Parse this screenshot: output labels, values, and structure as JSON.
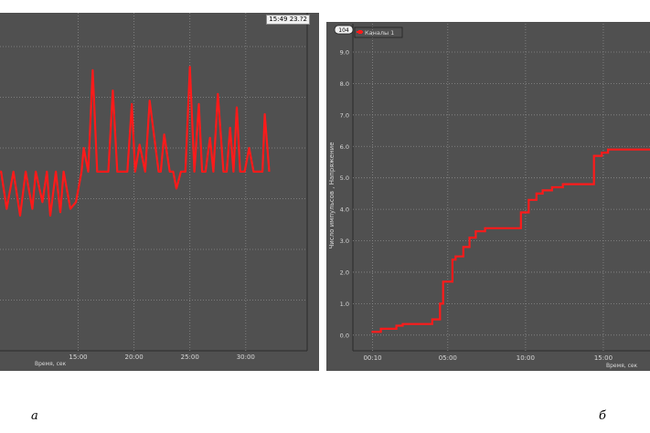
{
  "captions": {
    "a": "а",
    "b": "б"
  },
  "colors": {
    "background": "#505050",
    "series": "#ff1a1a",
    "grid": "#8a8a8a",
    "axis_text": "#d8d8d8"
  },
  "chart_data": [
    {
      "id": "a",
      "type": "line",
      "title": "",
      "timestamp": "15:49 23.?2",
      "xlabel": "Время, сек",
      "ylabel": "",
      "xticks": [
        "15:00",
        "20:00",
        "25:00",
        "30:00"
      ],
      "xlim": [
        8.0,
        35.5
      ],
      "ylim": [
        0,
        10
      ],
      "grid": true,
      "series": [
        {
          "x": [
            8.0,
            8.1,
            8.6,
            9.2,
            9.8,
            10.3,
            10.9,
            11.2,
            11.8,
            12.2,
            12.5,
            13.0,
            13.4,
            13.7,
            14.3,
            14.8,
            15.3,
            15.5,
            15.9,
            16.3,
            16.7,
            17.1,
            17.4,
            17.7,
            18.1,
            18.5,
            18.9,
            19.4,
            19.8,
            20.1,
            20.5,
            21.0,
            21.4,
            22.2,
            22.4,
            22.7,
            23.2,
            23.5,
            23.8,
            24.2,
            24.6,
            25.0,
            25.4,
            25.8,
            26.1,
            26.4,
            26.8,
            27.1,
            27.5,
            28.0,
            28.3,
            28.6,
            28.9,
            29.2,
            29.5,
            29.9,
            30.3,
            30.7,
            31.1,
            31.5,
            31.7,
            32.1
          ],
          "y": [
            5.3,
            5.3,
            4.2,
            5.3,
            4.0,
            5.3,
            4.2,
            5.3,
            4.4,
            5.3,
            4.0,
            5.3,
            4.1,
            5.3,
            4.2,
            4.4,
            5.3,
            6.0,
            5.3,
            8.3,
            5.3,
            5.3,
            5.3,
            5.3,
            7.7,
            5.3,
            5.3,
            5.3,
            7.3,
            5.3,
            6.1,
            5.3,
            7.4,
            5.3,
            5.3,
            6.4,
            5.3,
            5.3,
            4.8,
            5.3,
            5.3,
            8.4,
            5.3,
            7.3,
            5.3,
            5.3,
            6.3,
            5.3,
            7.6,
            5.3,
            5.3,
            6.6,
            5.3,
            7.2,
            5.3,
            5.3,
            6.0,
            5.3,
            5.3,
            5.3,
            7.0,
            5.3
          ]
        }
      ]
    },
    {
      "id": "b",
      "type": "line",
      "title": "",
      "legend_box_value": "104",
      "legend": [
        "Каналы 1"
      ],
      "xlabel": "Время, сек",
      "ylabel": "Число импульсов , Напряжение",
      "yticks": [
        "0.0",
        "1.0",
        "2.0",
        "3.0",
        "4.0",
        "5.0",
        "6.0",
        "7.0",
        "8.0",
        "9.0"
      ],
      "xticks": [
        "00:10",
        "05:00",
        "10:00",
        "15:00"
      ],
      "xlim": [
        -1.1,
        18.0
      ],
      "ylim": [
        -0.5,
        9.9
      ],
      "grid": true,
      "series": [
        {
          "name": "Каналы 1",
          "x": [
            0.1,
            0.7,
            0.7,
            1.7,
            1.7,
            2.1,
            2.1,
            4.0,
            4.0,
            4.5,
            4.5,
            4.7,
            4.7,
            5.3,
            5.3,
            5.5,
            5.5,
            6.0,
            6.0,
            6.4,
            6.4,
            6.8,
            6.8,
            7.4,
            7.4,
            9.7,
            9.7,
            10.2,
            10.2,
            10.7,
            10.7,
            11.1,
            11.1,
            11.7,
            11.7,
            12.4,
            12.4,
            14.4,
            14.4,
            14.9,
            14.9,
            15.3,
            15.3,
            18.0
          ],
          "y": [
            0.1,
            0.1,
            0.2,
            0.2,
            0.3,
            0.3,
            0.35,
            0.35,
            0.5,
            0.5,
            1.0,
            1.0,
            1.7,
            1.7,
            2.4,
            2.4,
            2.5,
            2.5,
            2.8,
            2.8,
            3.1,
            3.1,
            3.3,
            3.3,
            3.4,
            3.4,
            3.9,
            3.9,
            4.3,
            4.3,
            4.5,
            4.5,
            4.6,
            4.6,
            4.7,
            4.7,
            4.8,
            4.8,
            5.7,
            5.7,
            5.8,
            5.8,
            5.9,
            5.9
          ]
        }
      ]
    }
  ]
}
